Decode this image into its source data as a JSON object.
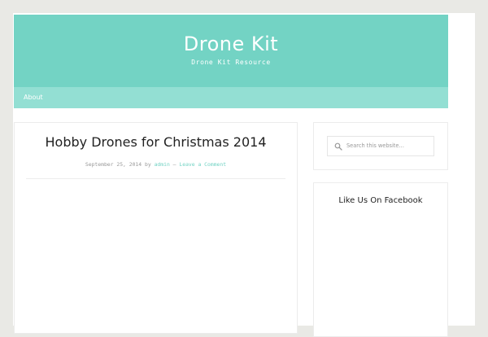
{
  "header": {
    "title": "Drone Kit",
    "description": "Drone Kit Resource"
  },
  "nav": {
    "items": [
      {
        "label": "About"
      }
    ]
  },
  "post": {
    "title": "Hobby Drones for Christmas 2014",
    "meta": {
      "date": "September 25, 2014",
      "by": "by",
      "author": "admin",
      "separator": "—",
      "comment_link": "Leave a Comment"
    }
  },
  "sidebar": {
    "search": {
      "placeholder": "Search this website…",
      "icon": "search-icon"
    },
    "facebook_widget": {
      "title": "Like Us On Facebook"
    }
  },
  "colors": {
    "accent": "#73d3c4",
    "nav": "#93dfd3",
    "background": "#e9e9e5"
  }
}
